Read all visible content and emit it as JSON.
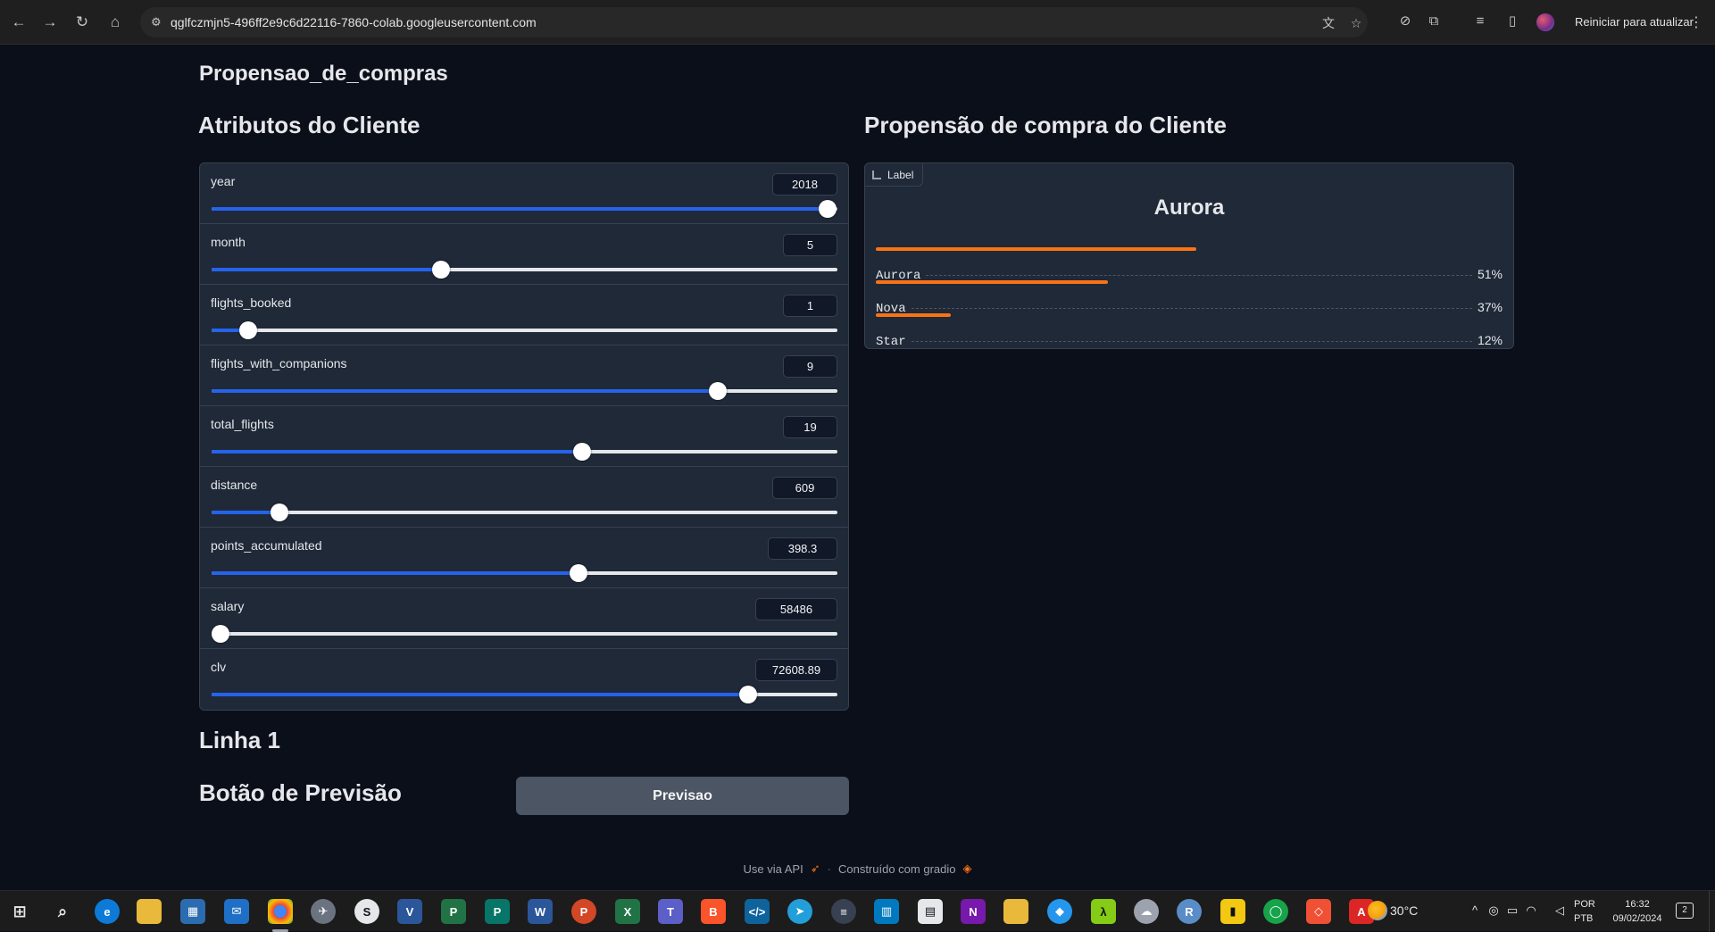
{
  "browser": {
    "url": "qglfczmjn5-496ff2e9c6d22116-7860-colab.googleusercontent.com",
    "update_button": "Reiniciar para atualizar",
    "icons": [
      "back-icon",
      "forward-icon",
      "reload-icon",
      "home-icon",
      "site-info-icon",
      "translate-icon",
      "star-icon",
      "extension-off-icon",
      "extensions-icon",
      "media-icon",
      "side-panel-icon",
      "profile-avatar",
      "menu-icon"
    ]
  },
  "page": {
    "title": "Propensao_de_compras",
    "attributes_heading": "Atributos do Cliente",
    "propensity_heading": "Propensão de compra do Cliente",
    "row_heading": "Linha 1",
    "button_heading": "Botão de Previsão",
    "predict_button": "Previsao"
  },
  "sliders": [
    {
      "label": "year",
      "value": "2018",
      "fraction": 0.985
    },
    {
      "label": "month",
      "value": "5",
      "fraction": 0.366
    },
    {
      "label": "flights_booked",
      "value": "1",
      "fraction": 0.059
    },
    {
      "label": "flights_with_companions",
      "value": "9",
      "fraction": 0.809
    },
    {
      "label": "total_flights",
      "value": "19",
      "fraction": 0.592
    },
    {
      "label": "distance",
      "value": "609",
      "fraction": 0.108
    },
    {
      "label": "points_accumulated",
      "value": "398.3",
      "fraction": 0.587
    },
    {
      "label": "salary",
      "value": "58486",
      "fraction": 0.014
    },
    {
      "label": "clv",
      "value": "72608.89",
      "fraction": 0.857
    }
  ],
  "label_output": {
    "badge": "Label",
    "top_label": "Aurora",
    "confidences": [
      {
        "label": "Aurora",
        "pct": "51%",
        "value": 0.51
      },
      {
        "label": "Nova",
        "pct": "37%",
        "value": 0.37
      },
      {
        "label": "Star",
        "pct": "12%",
        "value": 0.12
      }
    ]
  },
  "footer": {
    "api_text": "Use via API",
    "separator": "·",
    "built_text": "Construído com gradio"
  },
  "taskbar": {
    "weather": "30°C",
    "lang_1": "POR",
    "lang_2": "PTB",
    "time": "16:32",
    "date": "09/02/2024",
    "notifications": "2"
  },
  "colors": {
    "accent_blue": "#2563eb",
    "confidence_orange": "#f97316",
    "panel_bg": "#1f2937",
    "page_bg": "#0b0f19"
  }
}
